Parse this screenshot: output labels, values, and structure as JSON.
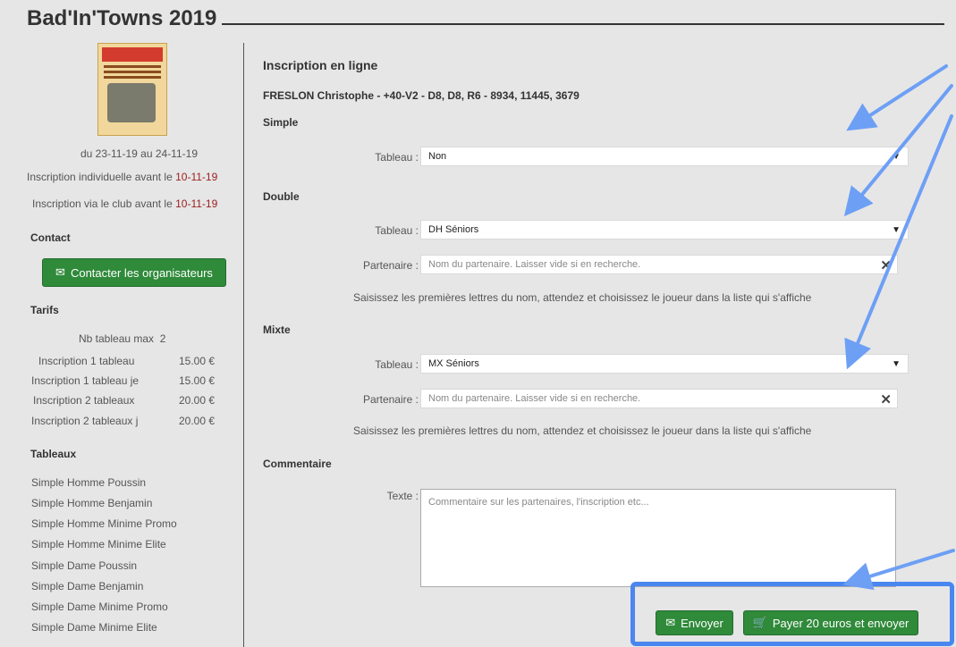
{
  "page": {
    "title": "Bad'In'Towns 2019"
  },
  "sidebar": {
    "dates": "du 23-11-19 au 24-11-19",
    "ind_label": "Inscription individuelle avant le",
    "ind_date": "10-11-19",
    "club_label": "Inscription via le club avant le",
    "club_date": "10-11-19",
    "contact_heading": "Contact",
    "contact_button": "Contacter les organisateurs",
    "tarifs_heading": "Tarifs",
    "nb_max_label": "Nb tableau max",
    "nb_max_value": "2",
    "tarifs": [
      {
        "label": "Inscription 1 tableau",
        "price": "15.00 €"
      },
      {
        "label": "Inscription 1 tableau je",
        "price": "15.00 €"
      },
      {
        "label": "Inscription 2 tableaux",
        "price": "20.00 €"
      },
      {
        "label": "Inscription 2 tableaux j",
        "price": "20.00 €"
      }
    ],
    "tableaux_heading": "Tableaux",
    "tableaux": [
      "Simple Homme Poussin",
      "Simple Homme Benjamin",
      "Simple Homme Minime Promo",
      "Simple Homme Minime Elite",
      "Simple Dame Poussin",
      "Simple Dame Benjamin",
      "Simple Dame Minime Promo",
      "Simple Dame Minime Elite"
    ]
  },
  "main": {
    "title": "Inscription en ligne",
    "player": "FRESLON Christophe - +40-V2 - D8, D8, R6 - 8934, 11445, 3679",
    "simple": {
      "heading": "Simple",
      "tableau_label": "Tableau :",
      "tableau_value": "Non"
    },
    "double": {
      "heading": "Double",
      "tableau_label": "Tableau :",
      "tableau_value": "DH Séniors",
      "partner_label": "Partenaire :",
      "partner_placeholder": "Nom du partenaire. Laisser vide si en recherche.",
      "hint": "Saisissez les premières lettres du nom, attendez et choisissez le joueur dans la liste qui s'affiche"
    },
    "mixte": {
      "heading": "Mixte",
      "tableau_label": "Tableau :",
      "tableau_value": "MX Séniors",
      "partner_label": "Partenaire :",
      "partner_placeholder": "Nom du partenaire. Laisser vide si en recherche.",
      "hint": "Saisissez les premières lettres du nom, attendez et choisissez le joueur dans la liste qui s'affiche"
    },
    "commentaire": {
      "heading": "Commentaire",
      "label": "Texte :",
      "placeholder": "Commentaire sur les partenaires, l'inscription etc..."
    }
  },
  "actions": {
    "send": "Envoyer",
    "pay": "Payer 20 euros et envoyer"
  },
  "colors": {
    "button_green": "#2f8a3a",
    "highlight_blue": "#4a86f0",
    "date_red": "#9a1d1d"
  }
}
